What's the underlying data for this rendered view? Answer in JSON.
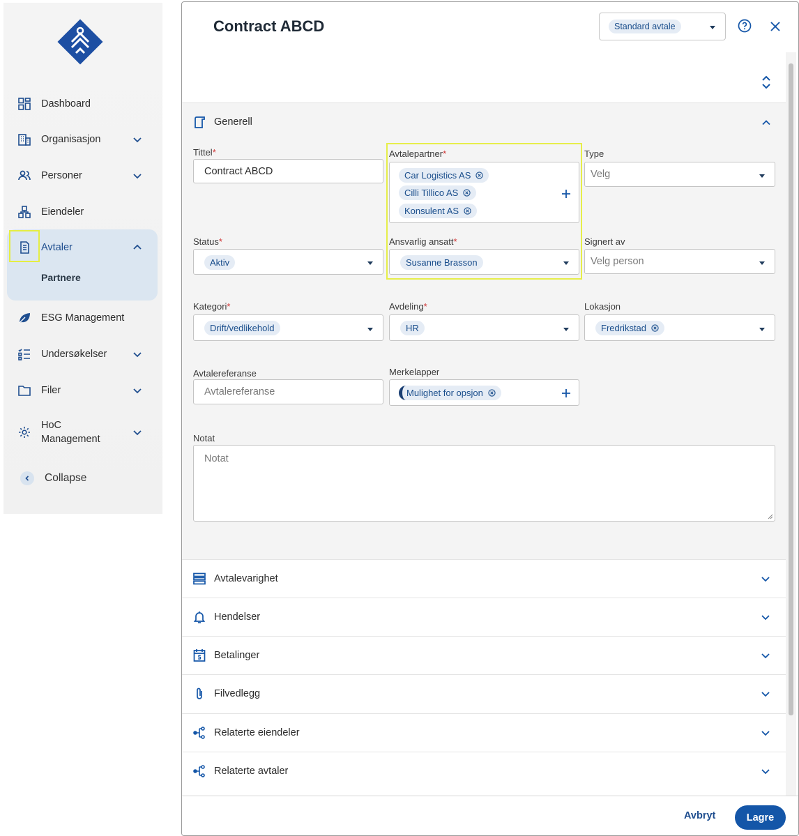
{
  "sidebar": {
    "items": [
      {
        "label": "Dashboard",
        "icon": "dashboard-grid-icon"
      },
      {
        "label": "Organisasjon",
        "icon": "building-icon",
        "expandable": true
      },
      {
        "label": "Personer",
        "icon": "people-icon",
        "expandable": true
      },
      {
        "label": "Eiendeler",
        "icon": "assets-icon"
      },
      {
        "label": "Avtaler",
        "icon": "contract-icon",
        "expandable": true,
        "expanded": true
      },
      {
        "label": "ESG Management",
        "icon": "leaf-icon"
      },
      {
        "label": "Undersøkelser",
        "icon": "checklist-icon",
        "expandable": true
      },
      {
        "label": "Filer",
        "icon": "folder-icon",
        "expandable": true
      },
      {
        "label": "HoC Management",
        "icon": "gear-icon",
        "expandable": true
      }
    ],
    "subitem": "Partnere",
    "collapse_label": "Collapse"
  },
  "modal": {
    "title": "Contract ABCD",
    "template_select": "Standard avtale",
    "sections": {
      "generell": "Generell",
      "rest": [
        "Avtalevarighet",
        "Hendelser",
        "Betalinger",
        "Filvedlegg",
        "Relaterte eiendeler",
        "Relaterte avtaler"
      ]
    },
    "fields": {
      "tittel": {
        "label": "Tittel",
        "value": "Contract ABCD"
      },
      "avtalepartner": {
        "label": "Avtalepartner",
        "chips": [
          "Car Logistics AS",
          "Cilli Tillico AS",
          "Konsulent AS"
        ]
      },
      "type": {
        "label": "Type",
        "placeholder": "Velg"
      },
      "status": {
        "label": "Status",
        "value": "Aktiv"
      },
      "ansvarlig": {
        "label": "Ansvarlig ansatt",
        "value": "Susanne Brasson"
      },
      "signert": {
        "label": "Signert av",
        "placeholder": "Velg person"
      },
      "kategori": {
        "label": "Kategori",
        "value": "Drift/vedlikehold"
      },
      "avdeling": {
        "label": "Avdeling",
        "value": "HR"
      },
      "lokasjon": {
        "label": "Lokasjon",
        "value": "Fredrikstad"
      },
      "avtalereferanse": {
        "label": "Avtalereferanse",
        "placeholder": "Avtalereferanse"
      },
      "merkelapper": {
        "label": "Merkelapper",
        "value": "Mulighet for opsjon"
      },
      "notat": {
        "label": "Notat",
        "placeholder": "Notat"
      }
    },
    "required_mark": "*",
    "footer": {
      "cancel": "Avbryt",
      "save": "Lagre"
    }
  },
  "colors": {
    "accent": "#1456a8",
    "chip_bg": "#e5ecf5",
    "chip_text": "#1a4e8c",
    "highlight": "#e6ee4a",
    "required": "#d03434"
  }
}
